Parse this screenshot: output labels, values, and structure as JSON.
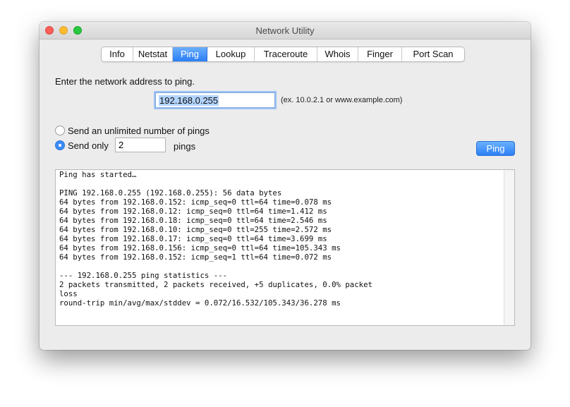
{
  "window": {
    "title": "Network Utility"
  },
  "tabs": [
    {
      "label": "Info",
      "w": 45
    },
    {
      "label": "Netstat",
      "w": 56
    },
    {
      "label": "Ping",
      "w": 49,
      "active": true
    },
    {
      "label": "Lookup",
      "w": 67
    },
    {
      "label": "Traceroute",
      "w": 89
    },
    {
      "label": "Whois",
      "w": 58
    },
    {
      "label": "Finger",
      "w": 62
    },
    {
      "label": "Port Scan",
      "w": 88
    }
  ],
  "ping": {
    "prompt": "Enter the network address to ping.",
    "address": "192.168.0.255",
    "example": "(ex. 10.0.2.1 or www.example.com)",
    "unlimited_label": "Send an unlimited number of pings",
    "send_only_label": "Send only",
    "count": "2",
    "pings_label": "pings",
    "button": "Ping",
    "mode": "send_only"
  },
  "output": {
    "lines": [
      "Ping has started…",
      "",
      "PING 192.168.0.255 (192.168.0.255): 56 data bytes",
      "64 bytes from 192.168.0.152: icmp_seq=0 ttl=64 time=0.078 ms",
      "64 bytes from 192.168.0.12: icmp_seq=0 ttl=64 time=1.412 ms",
      "64 bytes from 192.168.0.18: icmp_seq=0 ttl=64 time=2.546 ms",
      "64 bytes from 192.168.0.10: icmp_seq=0 ttl=255 time=2.572 ms",
      "64 bytes from 192.168.0.17: icmp_seq=0 ttl=64 time=3.699 ms",
      "64 bytes from 192.168.0.156: icmp_seq=0 ttl=64 time=105.343 ms",
      "64 bytes from 192.168.0.152: icmp_seq=1 ttl=64 time=0.072 ms",
      "",
      "--- 192.168.0.255 ping statistics ---",
      "2 packets transmitted, 2 packets received, +5 duplicates, 0.0% packet",
      "loss",
      "round-trip min/avg/max/stddev = 0.072/16.532/105.343/36.278 ms"
    ]
  },
  "colors": {
    "accent": "#2d80f6",
    "close": "#fc5f57",
    "minimize": "#fdbc2e",
    "maximize": "#28c840",
    "selection": "#b3d4fd"
  }
}
